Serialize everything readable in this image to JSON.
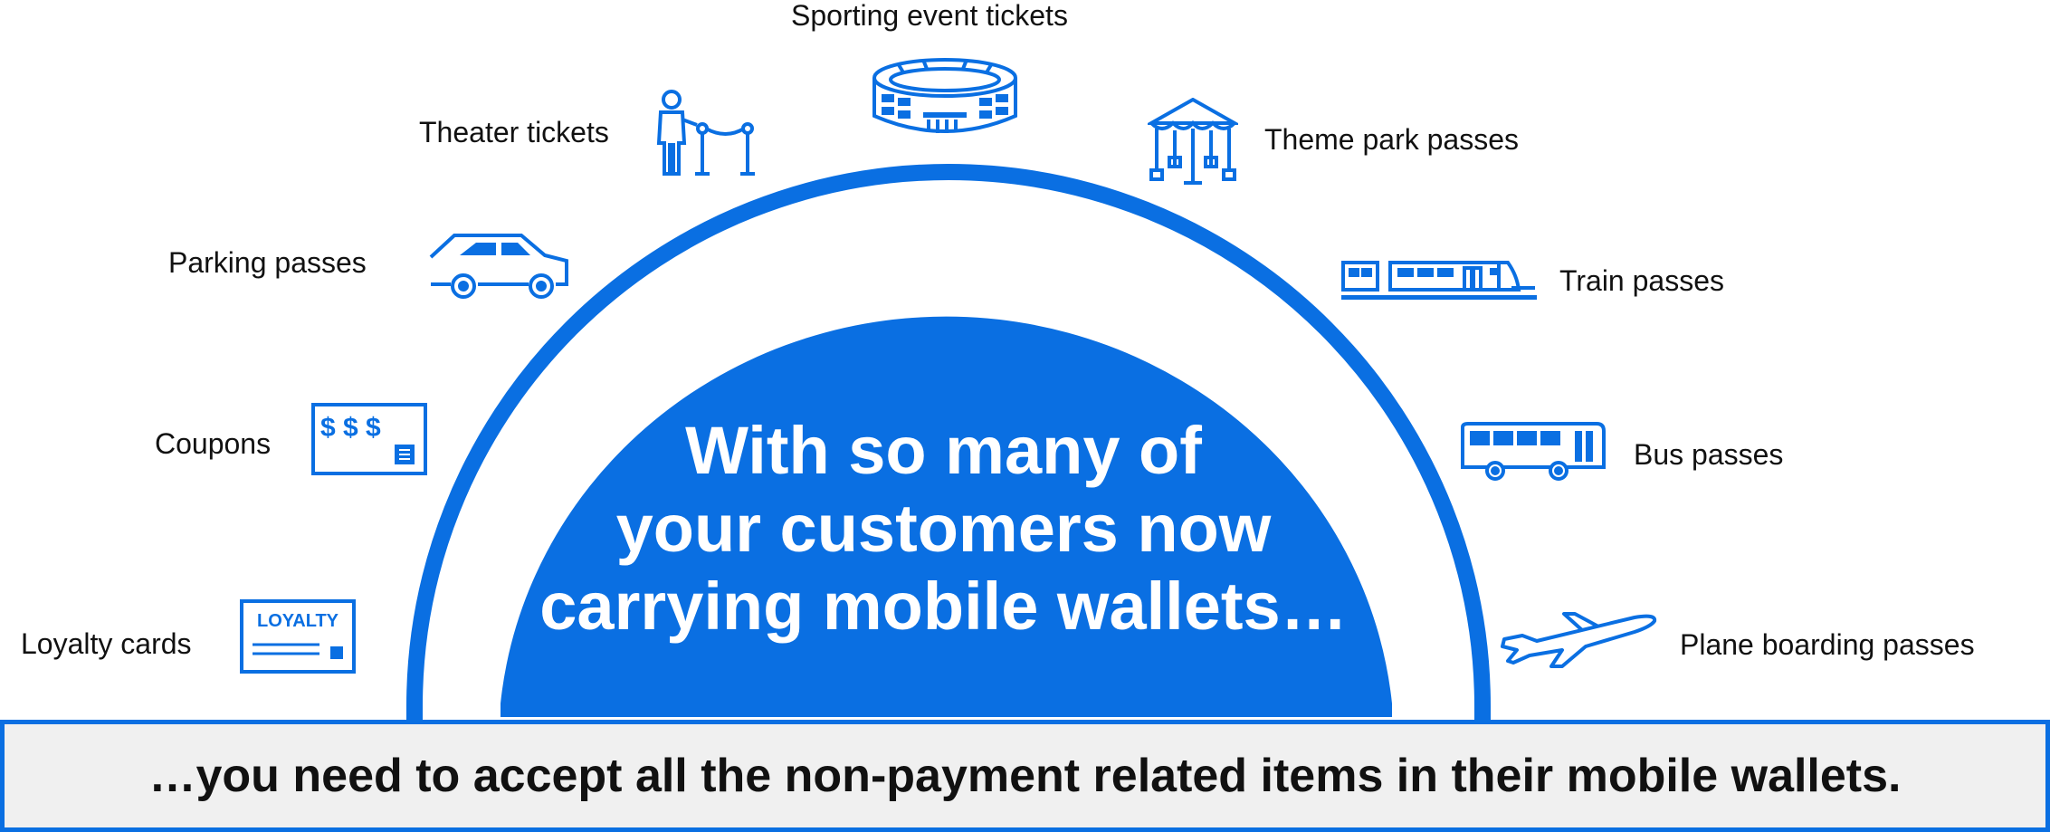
{
  "colors": {
    "accent": "#0a6fe2",
    "bar_background": "#f0f0f0",
    "text": "#111111"
  },
  "headline": {
    "line1": "With so many of",
    "line2": "your customers now",
    "line3": "carrying mobile wallets…"
  },
  "footer": {
    "text": "…you need to accept all the non-payment related items in their mobile wallets."
  },
  "items": {
    "sporting": {
      "label": "Sporting event tickets",
      "icon": "stadium-icon"
    },
    "theater": {
      "label": "Theater tickets",
      "icon": "usher-rope-icon"
    },
    "theme_park": {
      "label": "Theme park passes",
      "icon": "carousel-icon"
    },
    "parking": {
      "label": "Parking passes",
      "icon": "car-icon"
    },
    "train": {
      "label": "Train passes",
      "icon": "train-icon"
    },
    "coupons": {
      "label": "Coupons",
      "icon": "coupon-card-icon",
      "icon_text": "$ $ $"
    },
    "bus": {
      "label": "Bus passes",
      "icon": "bus-icon"
    },
    "loyalty": {
      "label": "Loyalty cards",
      "icon": "loyalty-card-icon",
      "icon_text": "LOYALTY"
    },
    "plane": {
      "label": "Plane boarding passes",
      "icon": "airplane-icon"
    }
  }
}
